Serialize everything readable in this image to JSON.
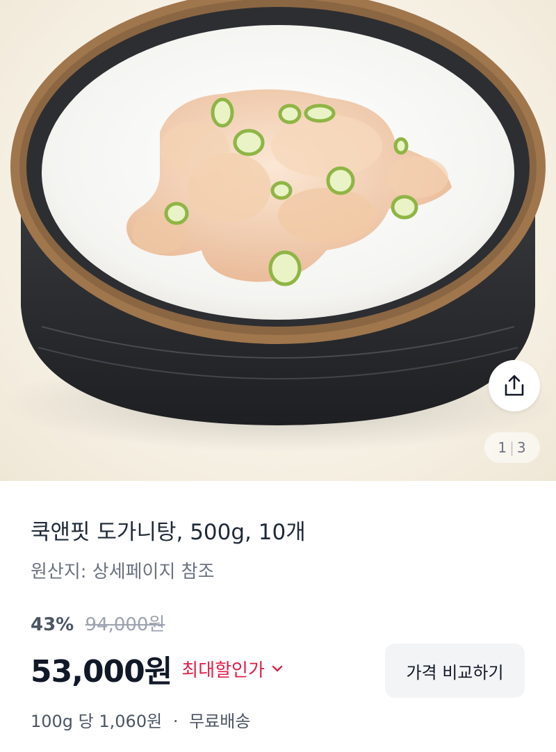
{
  "gallery": {
    "current": "1",
    "separator": "|",
    "total": "3",
    "image_alt": "국물 위에 대파를 얹은 도가니탕 한 그릇"
  },
  "product": {
    "title": "쿡앤핏 도가니탕, 500g, 10개",
    "origin": "원산지: 상세페이지 참조"
  },
  "pricing": {
    "discount_rate": "43%",
    "original_price": "94,000원",
    "price": "53,000원",
    "max_discount_label": "최대할인가",
    "compare_button": "가격 비교하기",
    "unit_price": "100g 당 1,060원",
    "dot": "·",
    "shipping": "무료배송"
  },
  "colors": {
    "accent_red": "#e11d48",
    "text_primary": "#111827",
    "text_secondary": "#6b7280"
  },
  "icons": {
    "share": "share-icon",
    "chevron": "chevron-down-icon"
  }
}
